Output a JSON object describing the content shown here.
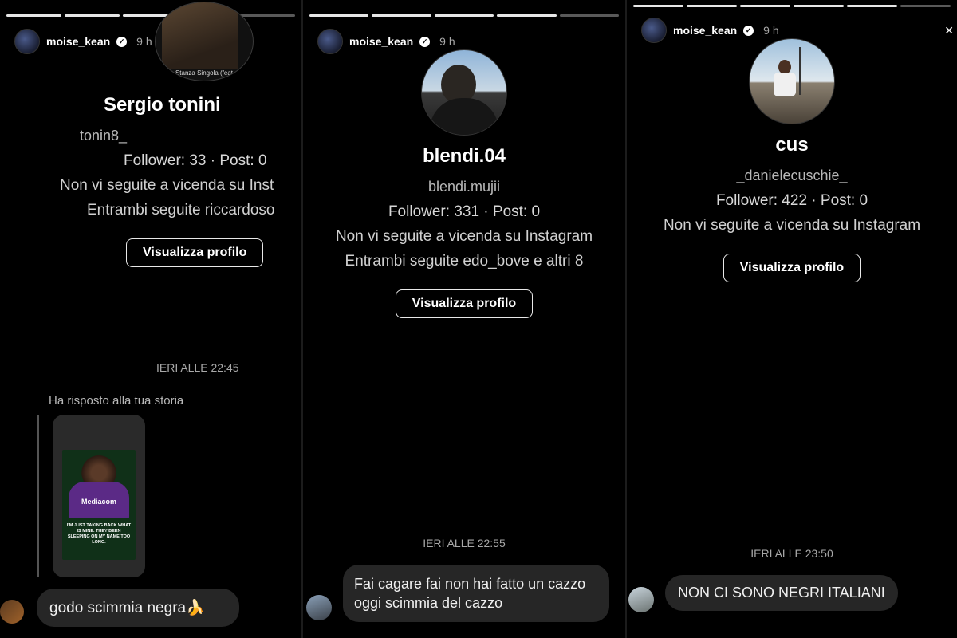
{
  "panels": [
    {
      "header": {
        "username": "moise_kean",
        "time": "9 h"
      },
      "music_label": "Stanza Singola (feat",
      "profile": {
        "name": "Sergio tonini",
        "handle": "tonin8_",
        "stats": "Follower: 33 · Post: 0",
        "line1": "Non vi seguite a vicenda su Inst",
        "line2": "Entrambi seguite riccardoso",
        "button": "Visualizza profilo"
      },
      "timestamp": "IERI ALLE 22:45",
      "reply_label": "Ha risposto alla tua storia",
      "story_quote": "I'M JUST TAKING BACK WHAT IS MINE. THEY BEEN SLEEPING ON MY NAME TOO LONG.",
      "story_sponsor": "Mediacom",
      "message": "godo scimmia negra🍌"
    },
    {
      "header": {
        "username": "moise_kean",
        "time": "9 h"
      },
      "profile": {
        "name": "blendi.04",
        "handle": "blendi.mujii",
        "stats": "Follower: 331 · Post: 0",
        "line1": "Non vi seguite a vicenda su Instagram",
        "line2": "Entrambi seguite edo_bove e altri 8",
        "button": "Visualizza profilo"
      },
      "timestamp": "IERI ALLE 22:55",
      "message_line1": "Fai cagare fai non hai fatto un cazzo",
      "message_line2": "oggi scimmia del cazzo"
    },
    {
      "header": {
        "username": "moise_kean",
        "time": "9 h"
      },
      "profile": {
        "name": "cus",
        "handle": "_danielecuschie_",
        "stats": "Follower: 422 · Post: 0",
        "line1": "Non vi seguite a vicenda su Instagram",
        "button": "Visualizza profilo"
      },
      "timestamp": "IERI ALLE 23:50",
      "message": "NON CI SONO NEGRI ITALIANI"
    }
  ],
  "colors": {
    "background": "#000000",
    "bubble": "#262626",
    "muted": "#a8a8a8",
    "fiorentina_purple": "#5b2a86"
  }
}
